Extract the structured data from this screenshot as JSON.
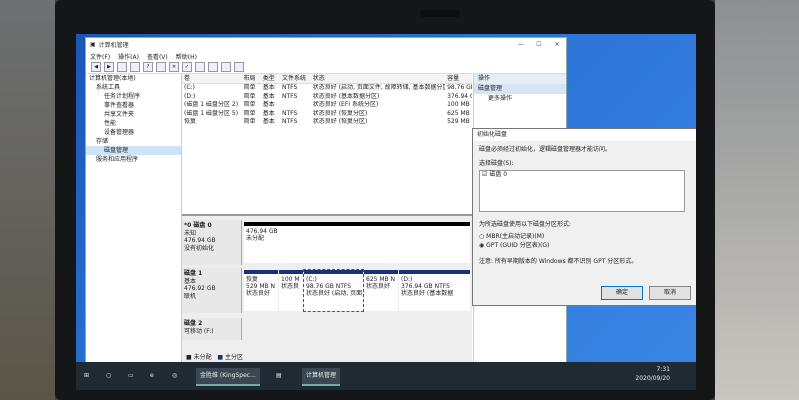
{
  "window": {
    "title": "计算机管理"
  },
  "menu": [
    "文件(F)",
    "操作(A)",
    "查看(V)",
    "帮助(H)"
  ],
  "tree": [
    {
      "label": "计算机管理(本地)",
      "indent": 0
    },
    {
      "label": "系统工具",
      "indent": 1
    },
    {
      "label": "任务计划程序",
      "indent": 2
    },
    {
      "label": "事件查看器",
      "indent": 2
    },
    {
      "label": "共享文件夹",
      "indent": 2
    },
    {
      "label": "性能",
      "indent": 2
    },
    {
      "label": "设备管理器",
      "indent": 2
    },
    {
      "label": "存储",
      "indent": 1
    },
    {
      "label": "磁盘管理",
      "indent": 2,
      "selected": true
    },
    {
      "label": "服务和应用程序",
      "indent": 1
    }
  ],
  "volume_table": {
    "headers": [
      "卷",
      "布局",
      "类型",
      "文件系统",
      "状态",
      "容量"
    ],
    "rows": [
      [
        "(C:)",
        "简单",
        "基本",
        "NTFS",
        "状态良好 (启动, 页面文件, 故障转储, 基本数据分区)",
        "98.76 GE"
      ],
      [
        "(D:)",
        "简单",
        "基本",
        "NTFS",
        "状态良好 (基本数据分区)",
        "376.94 G"
      ],
      [
        "(磁盘 1 磁盘分区 2)",
        "简单",
        "基本",
        "",
        "状态良好 (EFI 系统分区)",
        "100 MB"
      ],
      [
        "(磁盘 1 磁盘分区 5)",
        "简单",
        "基本",
        "NTFS",
        "状态良好 (恢复分区)",
        "625 MB"
      ],
      [
        "恢复",
        "简单",
        "基本",
        "NTFS",
        "状态良好 (恢复分区)",
        "529 MB"
      ]
    ]
  },
  "disks": [
    {
      "name": "*0 磁盘 0",
      "type": "未知",
      "size": "476.94 GB",
      "state": "没有初始化",
      "parts": [
        {
          "size": "476.94 GB",
          "status": "未分配",
          "unalloc": true
        }
      ]
    },
    {
      "name": "磁盘 1",
      "type": "基本",
      "size": "476.92 GB",
      "state": "联机",
      "parts": [
        {
          "name": "恢复",
          "size": "529 MB N",
          "status": "状态良好"
        },
        {
          "name": "",
          "size": "100 M",
          "status": "状态良"
        },
        {
          "name": "(C:)",
          "size": "98.76 GB NTFS",
          "status": "状态良好 (启动, 页面"
        },
        {
          "name": "",
          "size": "625 MB N",
          "status": "状态良好"
        },
        {
          "name": "(D:)",
          "size": "376.94 GB NTFS",
          "status": "状态良好 (基本数据"
        }
      ]
    },
    {
      "name": "磁盘 2",
      "type": "可移动 (F:)",
      "size": "",
      "state": "",
      "parts": []
    }
  ],
  "legend": [
    "未分配",
    "主分区"
  ],
  "actions": {
    "header": "操作",
    "selected": "磁盘管理",
    "more": "更多操作"
  },
  "dialog": {
    "title": "初始化磁盘",
    "message": "磁盘必须经过初始化，逻辑磁盘管理器才能访问。",
    "select_label": "选择磁盘(S):",
    "disk_item": "磁盘 0",
    "style_label": "为所选磁盘使用以下磁盘分区形式:",
    "option_mbr": "MBR(主启动记录)(M)",
    "option_gpt": "GPT (GUID 分区表)(G)",
    "note": "注意: 所有早期版本的 Windows 都不识别 GPT 分区形式。",
    "ok": "确定",
    "cancel": "取消"
  },
  "taskbar": {
    "app1": "金胜维 (KingSpec...",
    "app2": "计算机管理",
    "time": "7:31",
    "date": "2020/09/20"
  }
}
